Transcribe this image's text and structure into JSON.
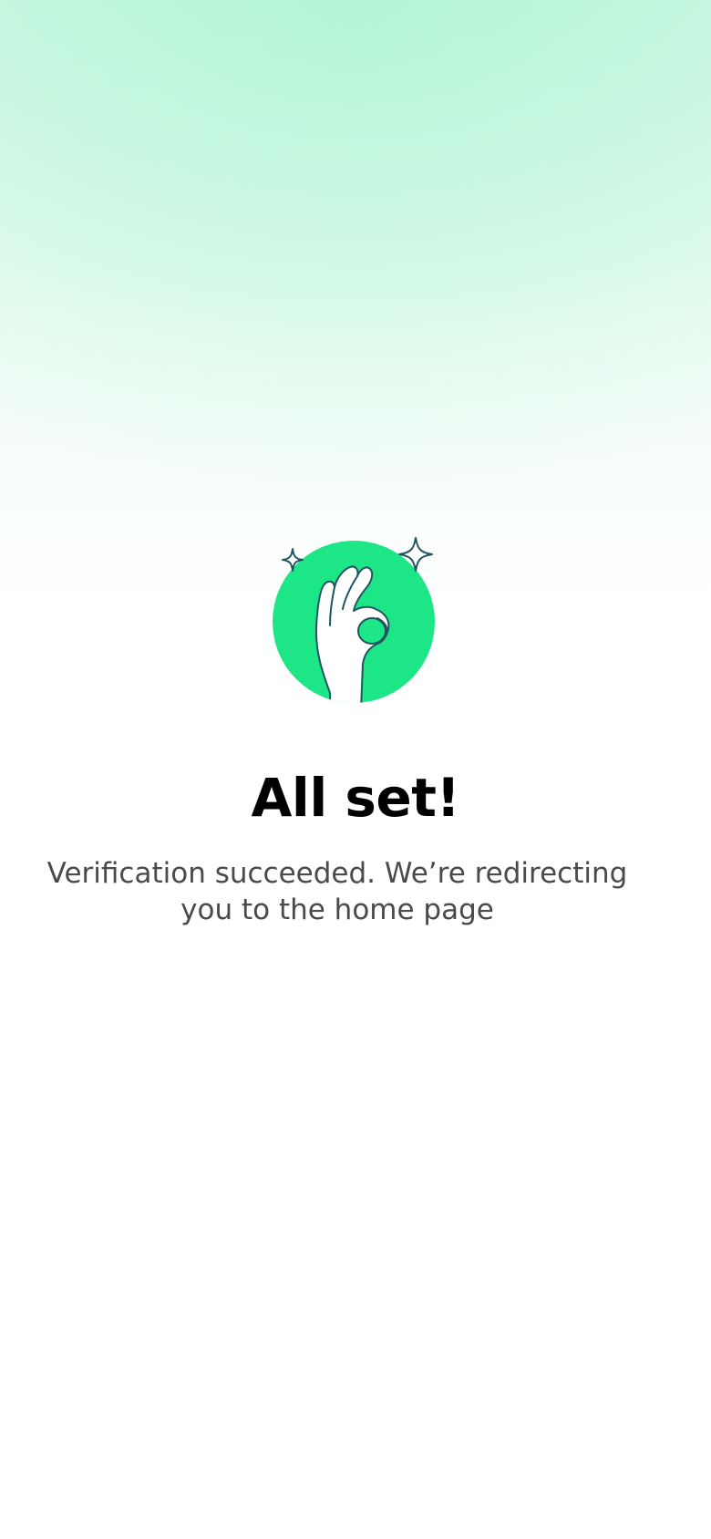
{
  "screen": {
    "title": "All set!",
    "message": "Verification succeeded. We’re redirecting you to the home page"
  },
  "illustration": {
    "icon": "ok-hand-sparkles-icon",
    "accent_color": "#1de687",
    "outline_color": "#1f5563"
  },
  "colors": {
    "background_top": "#d8f8e8",
    "background_bottom": "#ffffff",
    "title": "#000000",
    "message": "#4a4a4a"
  }
}
